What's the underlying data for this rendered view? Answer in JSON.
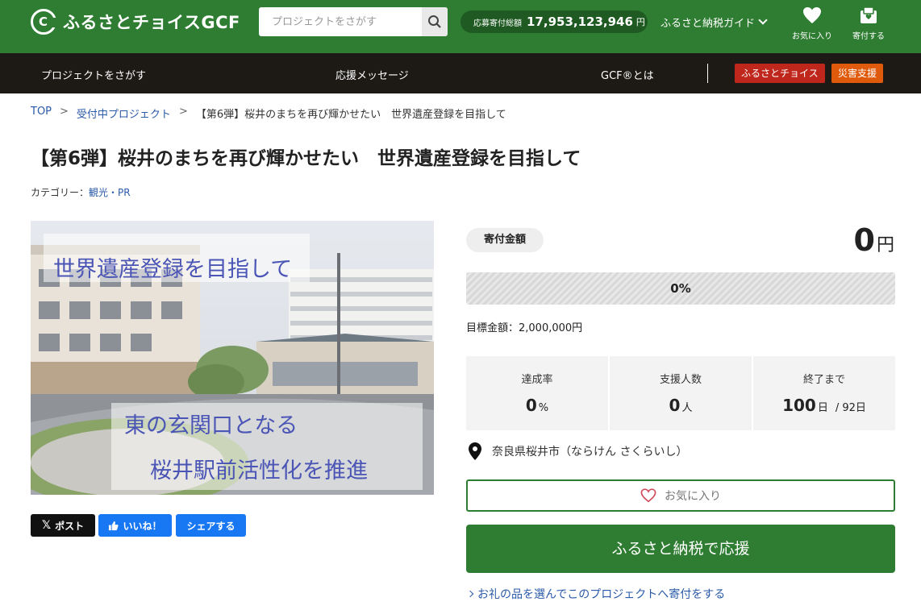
{
  "header": {
    "logo_text": "ふるさとチョイスGCF",
    "search_placeholder": "プロジェクトをさがす",
    "total_label": "応募寄付総額",
    "total_amount": "17,953,123,946",
    "total_unit": "円",
    "guide_label": "ふるさと納税ガイド",
    "favorites_label": "お気に入り",
    "donate_label": "寄付する"
  },
  "nav": {
    "items": [
      "プロジェクトをさがす",
      "応援メッセージ",
      "GCF®とは"
    ],
    "badge_choice": "ふるさとチョイス",
    "badge_disaster": "災害支援"
  },
  "breadcrumb": {
    "top": "TOP",
    "sep": ">",
    "projects": "受付中プロジェクト",
    "current": "【第6弾】桜井のまちを再び輝かせたい　世界遺産登録を目指して"
  },
  "project": {
    "title": "【第6弾】桜井のまちを再び輝かせたい　世界遺産登録を目指して",
    "category_label": "カテゴリー：",
    "category_value": "観光・PR",
    "image_text_1": "世界遺産登録を目指して",
    "image_text_2": "東の玄関口となる",
    "image_text_3": "桜井駅前活性化を推進"
  },
  "share": {
    "post": "ポスト",
    "like": "いいね！",
    "share": "シェアする"
  },
  "donation": {
    "amount_label": "寄付金額",
    "amount": "0",
    "amount_unit": "円",
    "progress": 0,
    "progress_text": "0%",
    "target": "目標金額：2,000,000円",
    "stats": {
      "rate_label": "達成率",
      "rate_value": "0",
      "rate_unit": "%",
      "supporters_label": "支援人数",
      "supporters_value": "0",
      "supporters_unit": "人",
      "remaining_label": "終了まで",
      "remaining_value": "100",
      "remaining_unit": "日",
      "remaining_total": "/ 92日"
    },
    "location": "奈良県桜井市（ならけん さくらいし）",
    "favorite_button": "お気に入り",
    "donate_button": "ふるさと納税で応援",
    "gift_link": "お礼の品を選んでこのプロジェクトへ寄付をする"
  },
  "colors": {
    "brand_green": "#2f7d32",
    "nav_dark": "#1d1a16",
    "badge_red": "#c0271c",
    "badge_orange": "#e05a0c",
    "link_blue": "#2a5aa8"
  }
}
